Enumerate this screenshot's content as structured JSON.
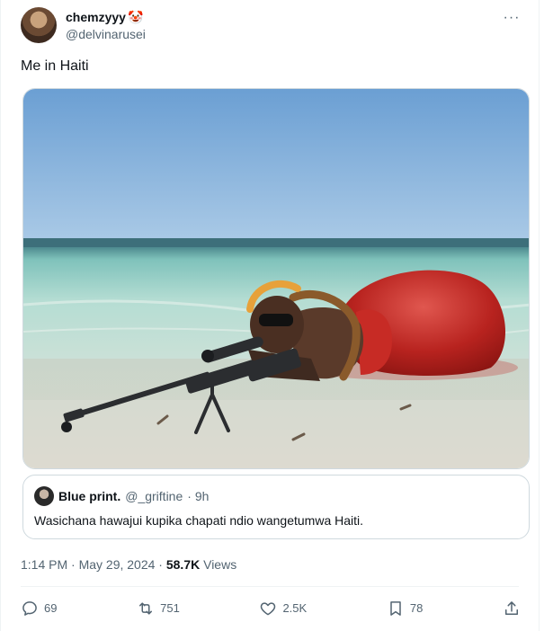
{
  "author": {
    "display_name": "chemzyyy",
    "name_emoji": "🤡",
    "handle": "@delvinarusei"
  },
  "tweet": {
    "text": "Me in Haiti",
    "timestamp": "1:14 PM · May 29, 2024 · ",
    "views_count": "58.7K",
    "views_label": " Views"
  },
  "quote": {
    "display_name": "Blue print.",
    "handle": "@_griftine",
    "time": "· 9h",
    "text": "Wasichana hawajui kupika chapati ndio wangetumwa Haiti."
  },
  "actions": {
    "replies": "69",
    "reposts": "751",
    "likes": "2.5K",
    "bookmarks": "78"
  },
  "icons": {
    "more": "more-dots-icon",
    "reply": "reply-icon",
    "repost": "repost-icon",
    "like": "heart-icon",
    "bookmark": "bookmark-icon",
    "share": "share-icon"
  },
  "colors": {
    "text_primary": "#0f1419",
    "text_secondary": "#536471",
    "border": "#cfd9de"
  }
}
